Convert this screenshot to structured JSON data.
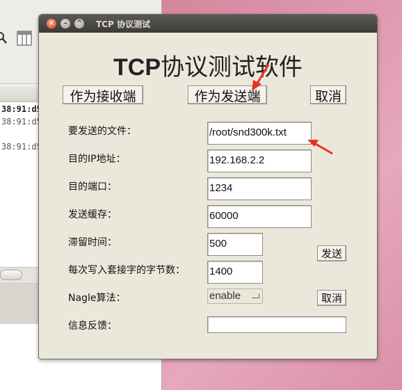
{
  "background_window": {
    "rows": [
      "38:91:d5",
      "38:91:d5",
      "38:91:d5"
    ]
  },
  "dialog": {
    "window_title": "TCP  协议测试",
    "heading_latin": "TCP",
    "heading_cjk": "协议测试软件",
    "buttons": {
      "receiver": "作为接收端",
      "sender": "作为发送端",
      "cancel_top": "取消",
      "send": "发送",
      "cancel_bottom": "取消"
    },
    "fields": {
      "file_label": "要发送的文件：",
      "file_value": "/root/snd300k.txt",
      "ip_label": "目的IP地址：",
      "ip_value": "192.168.2.2",
      "port_label": "目的端口：",
      "port_value": "1234",
      "buffer_label": "发送缓存：",
      "buffer_value": "60000",
      "linger_label": "滞留时间：",
      "linger_value": "500",
      "bytes_label": "每次写入套接字的字节数：",
      "bytes_value": "1400",
      "nagle_label": "Nagle算法：",
      "nagle_value": "enable",
      "feedback_label": "信息反馈：",
      "feedback_value": ""
    }
  },
  "colors": {
    "annotation_arrow": "#e8321e",
    "dialog_bg": "#ebe8db",
    "titlebar": "#3c3b37"
  }
}
